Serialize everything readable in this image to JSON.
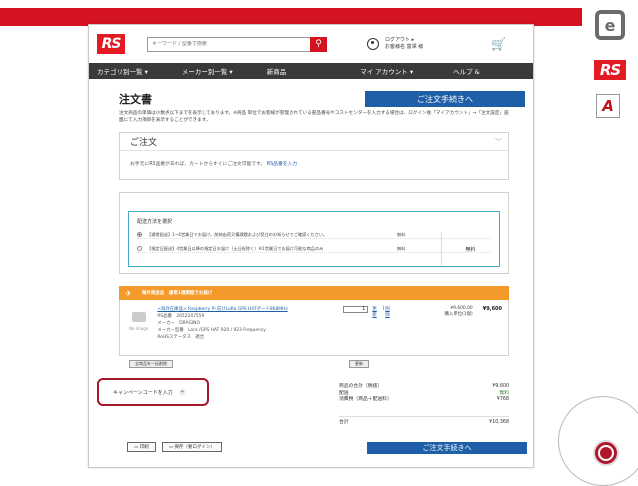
{
  "slide": {
    "accent_color": "#d3131f",
    "side_logos": [
      "e-logo-icon",
      "RS",
      "A"
    ]
  },
  "header": {
    "logo": "RS",
    "search_placeholder": "キーワード / 型番で検索",
    "account_line1": "ログアウト ▸",
    "account_line2": "お客様名 富澤 様"
  },
  "nav": [
    "カテゴリ別一覧 ▾",
    "メーカー別一覧 ▾",
    "新商品",
    "マイ アカウント ▾",
    "ヘルプ &"
  ],
  "page": {
    "title": "注文書",
    "checkout_label": "ご注文手続きへ",
    "notice": "注文商品の単価は小数点以下までを表示しております。※商品 単位でお客様が管理されている部品番号やコストセンターを入力する場合は、ログイン後「マイアカウント」→「注文設定」画面にて入力項目を表示することができます。"
  },
  "order_box": {
    "title": "ご注文",
    "hint": "お手元にRS品番があれば、カートからすぐにご注文可能です。",
    "hint_link": "RS品番を入力"
  },
  "shipping": {
    "title": "配送方法を選択",
    "options": [
      {
        "label": "【通常配送】1~4営業日でお届け。前納出荷又備課題および受注のお知らせでご確認ください。",
        "fee": "無料",
        "selected": true
      },
      {
        "label": "【指定日配送】4営業日以降の指定日お届け（土日祝除く）※1営業日でお届け可能な商品のみ",
        "fee": "無料",
        "selected": false
      }
    ],
    "side_label": "無料"
  },
  "group": {
    "label": "海外発送品　通常1週間程でお届け"
  },
  "item": {
    "noimage": "No image",
    "name": "<海外在庫品> Raspberry Pi 向けLoRa GPS HATボード868MHz",
    "rs_no": "RS品番　2052247559",
    "maker": "メーカー　DRAGINO",
    "maker_no": "メーカー型番　Lora /GPS HAT 920 / 923 Frequency",
    "rohs": "RoHSステータス　適合",
    "qty": "1",
    "update_link": "更新",
    "delete_link": "削除",
    "unit_price": "¥9,600.00",
    "unit_note": "購入単位(1個)",
    "subtotal": "¥9,600"
  },
  "buttons": {
    "delete_all": "全商品を一括削除",
    "update": "更新",
    "print": "印刷",
    "save": "保存（要ログイン）"
  },
  "campaign": {
    "label": "キャンペーンコードを入力"
  },
  "totals": {
    "rows": [
      {
        "label": "商品の合計（税抜）",
        "value": "¥9,600"
      },
      {
        "label": "配送",
        "value": "無料"
      },
      {
        "label": "消費税（商品＋配送料）",
        "value": "¥768"
      }
    ],
    "grand_label": "合計",
    "grand_value": "¥10,368"
  }
}
